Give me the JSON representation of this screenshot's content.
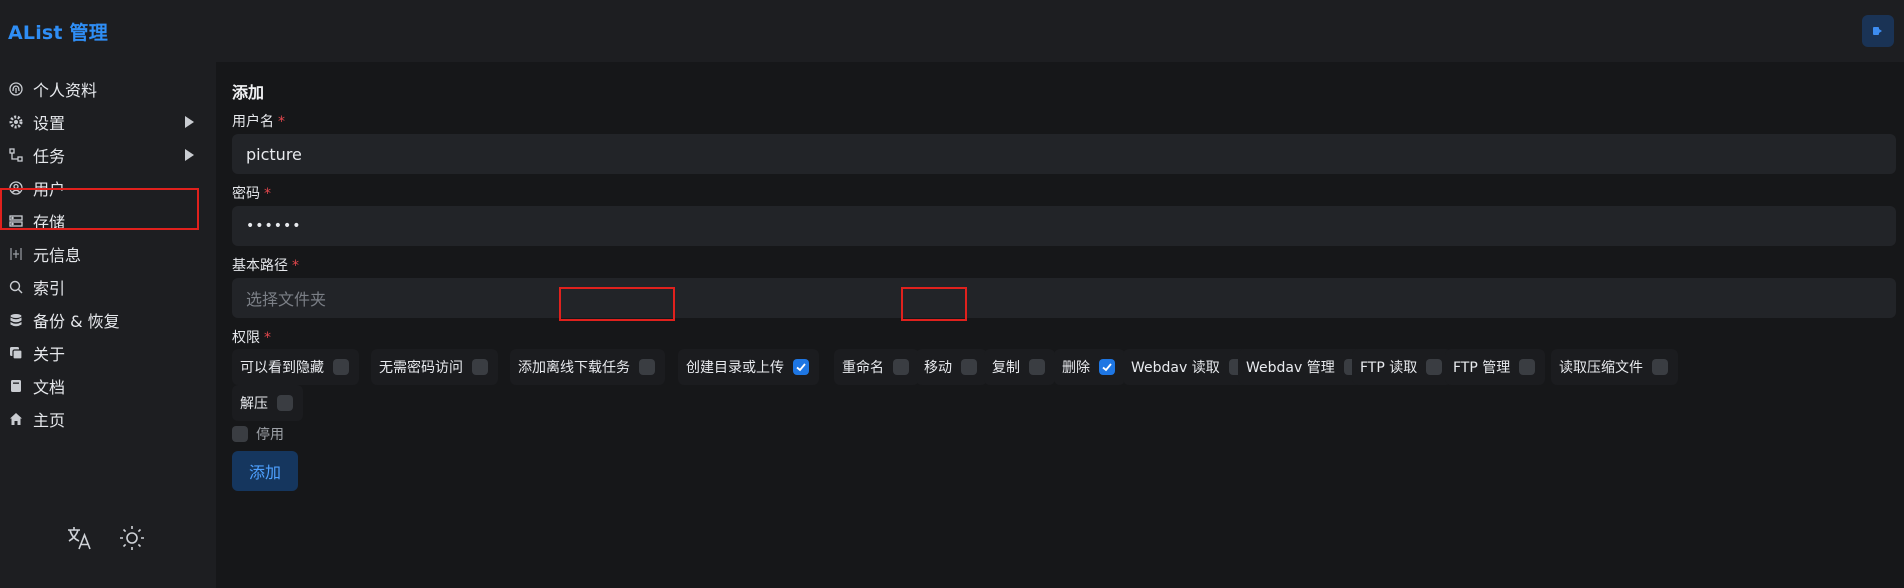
{
  "app": {
    "title": "AList 管理"
  },
  "sidebar": {
    "items": [
      {
        "label": "个人资料",
        "icon": "fingerprint-icon"
      },
      {
        "label": "设置",
        "icon": "gear-icon"
      },
      {
        "label": "任务",
        "icon": "tasks-icon"
      },
      {
        "label": "用户",
        "icon": "user-circle-icon"
      },
      {
        "label": "存储",
        "icon": "storage-icon"
      },
      {
        "label": "元信息",
        "icon": "metadata-icon"
      },
      {
        "label": "索引",
        "icon": "search-icon"
      },
      {
        "label": "备份 & 恢复",
        "icon": "database-icon"
      },
      {
        "label": "关于",
        "icon": "copy-icon"
      },
      {
        "label": "文档",
        "icon": "book-icon"
      },
      {
        "label": "主页",
        "icon": "home-icon"
      }
    ]
  },
  "form": {
    "title": "添加",
    "username": {
      "label": "用户名",
      "required": "*",
      "value": "picture"
    },
    "password": {
      "label": "密码",
      "required": "*",
      "value": "••••••"
    },
    "base_path": {
      "label": "基本路径",
      "required": "*",
      "placeholder": "选择文件夹"
    },
    "permissions": {
      "label": "权限",
      "required": "*",
      "items": [
        {
          "label": "可以看到隐藏",
          "checked": false
        },
        {
          "label": "无需密码访问",
          "checked": false
        },
        {
          "label": "添加离线下载任务",
          "checked": false
        },
        {
          "label": "创建目录或上传",
          "checked": true
        },
        {
          "label": "重命名",
          "checked": false
        },
        {
          "label": "移动",
          "checked": false
        },
        {
          "label": "复制",
          "checked": false
        },
        {
          "label": "删除",
          "checked": true
        },
        {
          "label": "Webdav 读取",
          "checked": false
        },
        {
          "label": "Webdav 管理",
          "checked": false
        },
        {
          "label": "FTP 读取",
          "checked": false
        },
        {
          "label": "FTP 管理",
          "checked": false
        },
        {
          "label": "读取压缩文件",
          "checked": false
        },
        {
          "label": "解压",
          "checked": false
        }
      ]
    },
    "disabled": {
      "label": "停用",
      "checked": false
    },
    "submit_label": "添加"
  },
  "colors": {
    "accent": "#2f8ef5",
    "checkbox_on": "#1e76e3",
    "highlight": "#e0211d",
    "required": "#e5484d"
  }
}
